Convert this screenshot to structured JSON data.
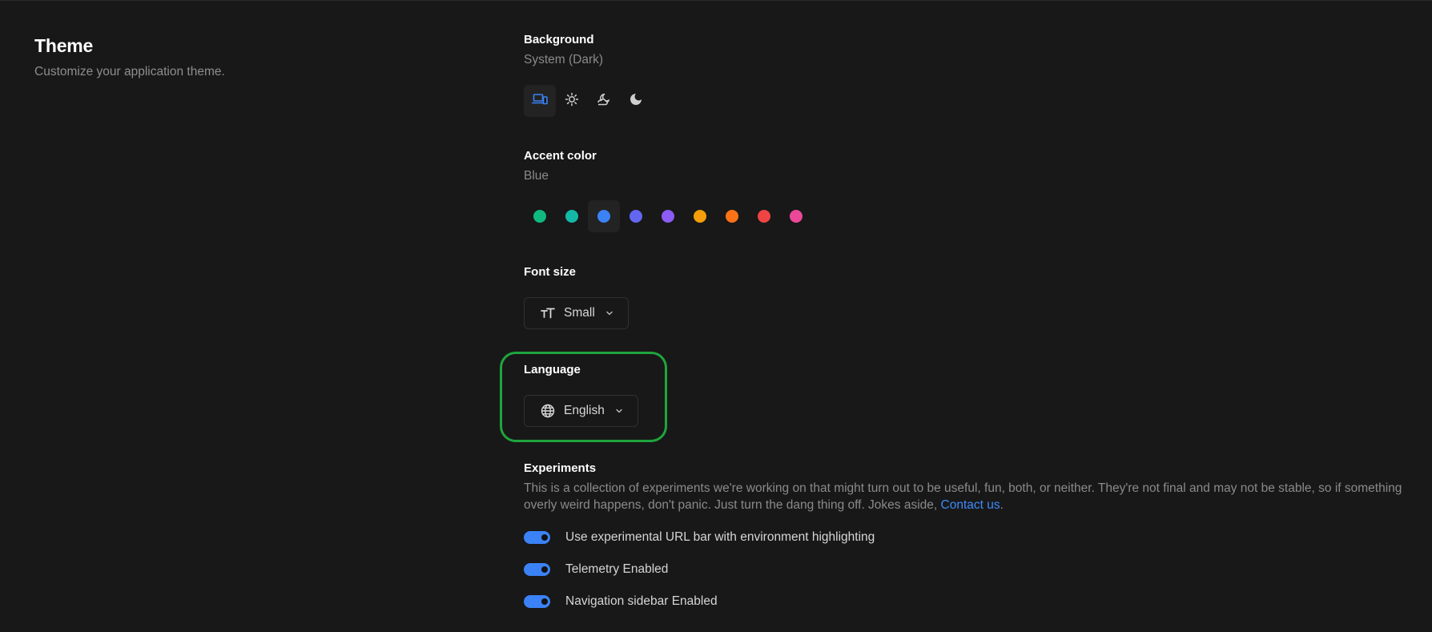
{
  "header": {
    "title": "Theme",
    "subtitle": "Customize your application theme."
  },
  "background": {
    "label": "Background",
    "value": "System (Dark)",
    "options": [
      {
        "name": "system",
        "icon": "laptop-phone-icon",
        "selected": true
      },
      {
        "name": "light",
        "icon": "sun-icon",
        "selected": false
      },
      {
        "name": "dim",
        "icon": "moon-cloud-icon",
        "selected": false
      },
      {
        "name": "dark",
        "icon": "moon-icon",
        "selected": false
      }
    ]
  },
  "accent": {
    "label": "Accent color",
    "value": "Blue",
    "colors": [
      "#10b981",
      "#14b8a6",
      "#3b82f6",
      "#6366f1",
      "#8b5cf6",
      "#f59e0b",
      "#f97316",
      "#ef4444",
      "#ec4899"
    ],
    "selected_index": 2
  },
  "font_size": {
    "label": "Font size",
    "value": "Small",
    "icon": "text-size-icon"
  },
  "language": {
    "label": "Language",
    "value": "English",
    "icon": "globe-icon"
  },
  "experiments": {
    "label": "Experiments",
    "description": "This is a collection of experiments we're working on that might turn out to be useful, fun, both, or neither. They're not final and may not be stable, so if something overly weird happens, don't panic. Just turn the dang thing off. Jokes aside,",
    "contact_link": "Contact us",
    "contact_suffix": ".",
    "items": [
      {
        "label": "Use experimental URL bar with environment highlighting",
        "enabled": true
      },
      {
        "label": "Telemetry Enabled",
        "enabled": true
      },
      {
        "label": "Navigation sidebar Enabled",
        "enabled": true
      }
    ]
  },
  "colors": {
    "accent": "#3b82f6",
    "link": "#3d8bfd",
    "highlight": "#1fa53d",
    "background": "#181818"
  }
}
